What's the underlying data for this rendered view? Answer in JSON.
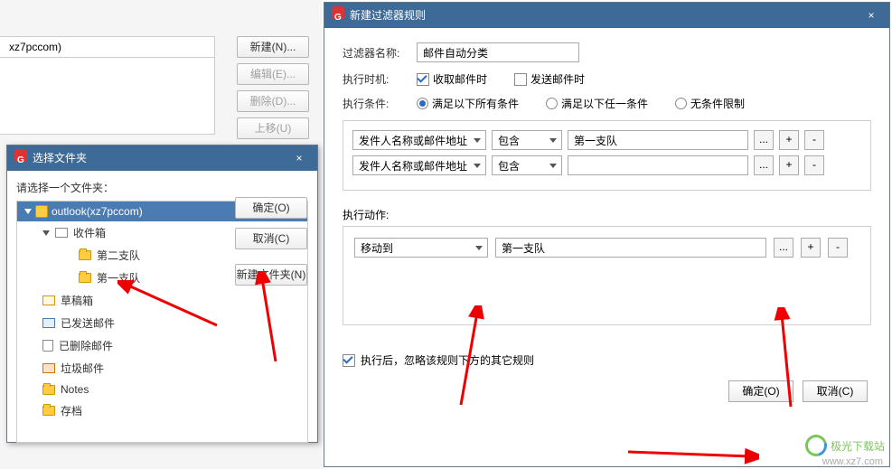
{
  "bg": {
    "crumb": "xz7pccom)"
  },
  "side_buttons": {
    "new": "新建(N)...",
    "edit": "编辑(E)...",
    "delete": "删除(D)...",
    "moveup": "上移(U)"
  },
  "folder_dialog": {
    "title": "选择文件夹",
    "prompt": "请选择一个文件夹：",
    "close": "×",
    "account": "outlook(xz7pccom)",
    "items": {
      "inbox": "收件箱",
      "team2": "第二支队",
      "team1": "第一支队",
      "drafts": "草稿箱",
      "sent": "已发送邮件",
      "deleted": "已删除邮件",
      "spam": "垃圾邮件",
      "notes": "Notes",
      "archive": "存档"
    },
    "ok": "确定(O)",
    "cancel": "取消(C)",
    "newfolder": "新建文件夹(N)"
  },
  "filter": {
    "title": "新建过滤器规则",
    "close": "×",
    "name_label": "过滤器名称:",
    "name_value": "邮件自动分类",
    "when_label": "执行时机:",
    "when_recv": "收取邮件时",
    "when_send": "发送邮件时",
    "cond_label": "执行条件:",
    "cond_all": "满足以下所有条件",
    "cond_any": "满足以下任一条件",
    "cond_none": "无条件限制",
    "field_sel": "发件人名称或邮件地址",
    "op_sel": "包含",
    "val1": "第一支队",
    "val2": "",
    "dots": "...",
    "plus": "+",
    "minus": "-",
    "action_label": "执行动作:",
    "action_sel": "移动到",
    "action_val": "第一支队",
    "ignore": "执行后，忽略该规则下方的其它规则",
    "ok": "确定(O)",
    "cancel": "取消(C)"
  },
  "watermark": {
    "text": "极光下载站",
    "url": "www.xz7.com"
  }
}
